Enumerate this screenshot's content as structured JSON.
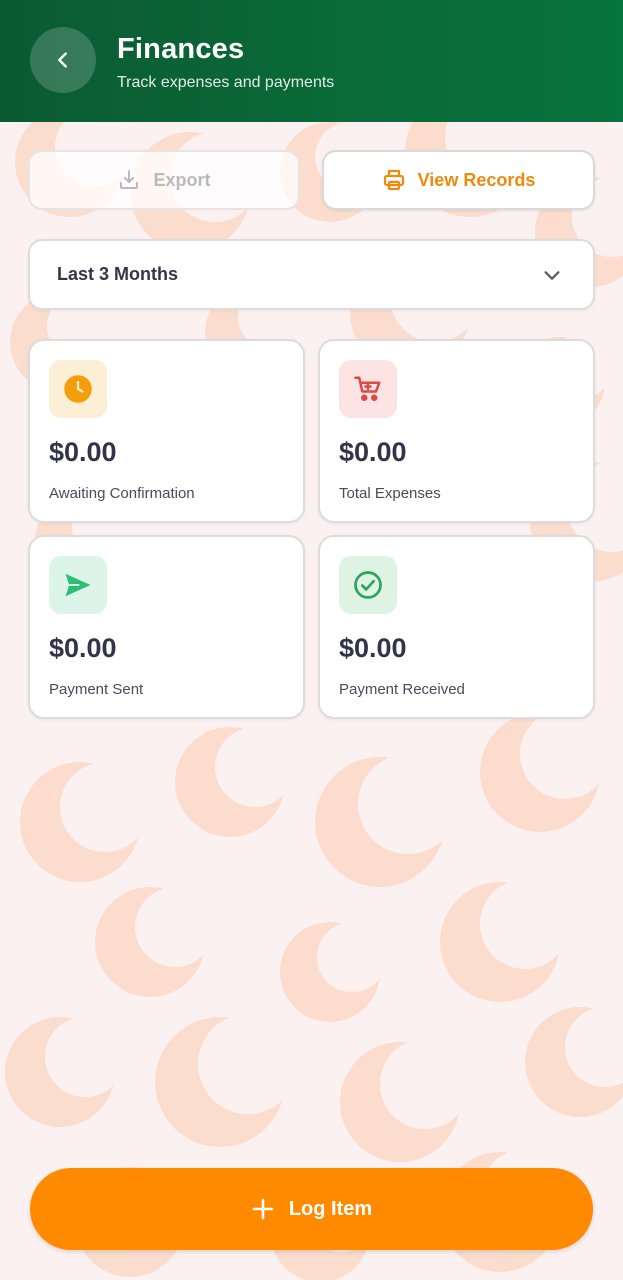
{
  "header": {
    "title": "Finances",
    "subtitle": "Track expenses and payments",
    "back_icon": "chevron-left-icon"
  },
  "actions": {
    "export_label": "Export",
    "export_icon": "download-icon",
    "view_records_label": "View Records",
    "view_records_icon": "printer-icon"
  },
  "filter": {
    "selected": "Last 3 Months",
    "icon": "chevron-down-icon"
  },
  "cards": [
    {
      "amount": "$0.00",
      "label": "Awaiting Confirmation",
      "icon": "clock-icon",
      "accent": "#f59e0b"
    },
    {
      "amount": "$0.00",
      "label": "Total Expenses",
      "icon": "cart-icon",
      "accent": "#e04848"
    },
    {
      "amount": "$0.00",
      "label": "Payment Sent",
      "icon": "send-icon",
      "accent": "#2cbf73"
    },
    {
      "amount": "$0.00",
      "label": "Payment Received",
      "icon": "check-circle-icon",
      "accent": "#2ea65a"
    }
  ],
  "footer": {
    "log_label": "Log Item",
    "log_icon": "plus-icon"
  },
  "colors": {
    "header_green": "#0a6a38",
    "primary_orange": "#ff8a00",
    "background": "#fcf1f1"
  }
}
